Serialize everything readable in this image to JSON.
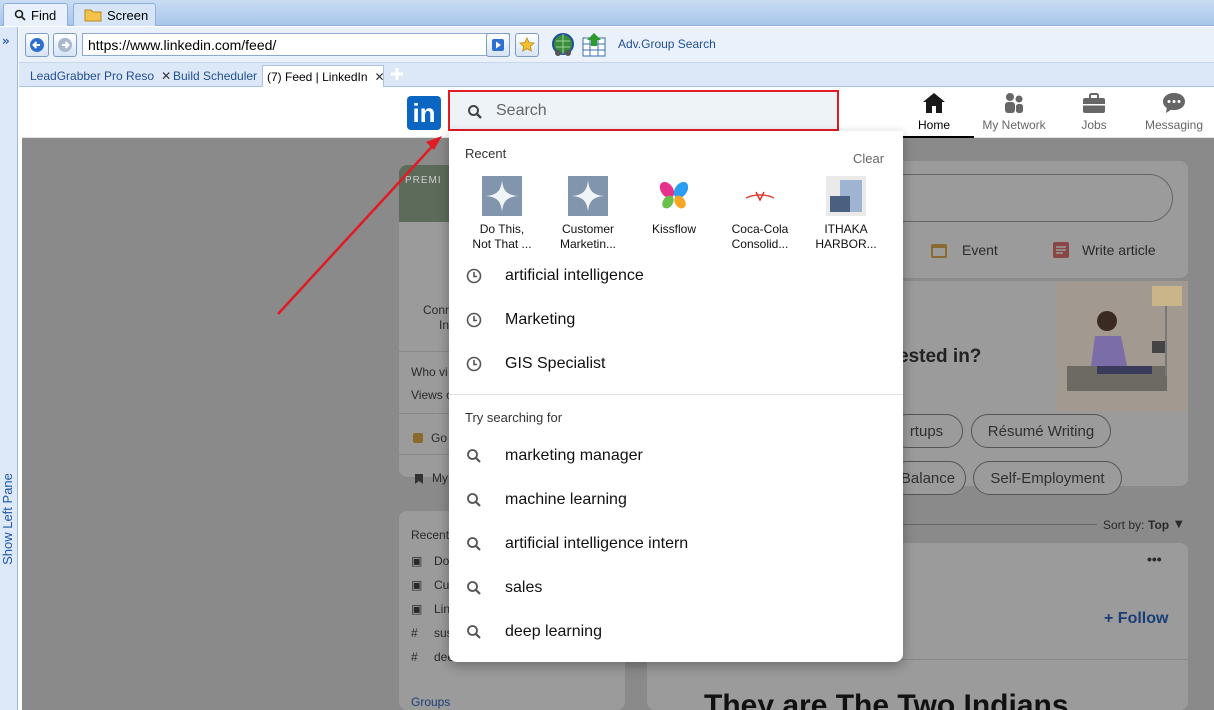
{
  "top_tabs": [
    {
      "label": "Find",
      "icon": "magnifier-icon"
    },
    {
      "label": "Screen",
      "icon": "folder-icon"
    }
  ],
  "left_pane": {
    "label": "Show Left Pane"
  },
  "toolbar": {
    "url": "https://www.linkedin.com/feed/",
    "adv_search": "Adv.Group Search"
  },
  "browser_tabs": [
    {
      "label": "LeadGrabber Pro Reso"
    },
    {
      "label": "Build Scheduler"
    },
    {
      "label": "(7) Feed | LinkedIn"
    }
  ],
  "linkedin": {
    "logo": "in",
    "search_placeholder": "Search",
    "nav": [
      {
        "label": "Home",
        "icon": "home-icon"
      },
      {
        "label": "My Network",
        "icon": "network-icon"
      },
      {
        "label": "Jobs",
        "icon": "briefcase-icon"
      },
      {
        "label": "Messaging",
        "icon": "messaging-icon"
      }
    ]
  },
  "dropdown": {
    "recent_title": "Recent",
    "clear": "Clear",
    "recent_entities": [
      {
        "line1": "Do This,",
        "line2": "Not That ..."
      },
      {
        "line1": "Customer",
        "line2": "Marketin..."
      },
      {
        "line1": "Kissflow",
        "line2": ""
      },
      {
        "line1": "Coca-Cola",
        "line2": "Consolid..."
      },
      {
        "line1": "ITHAKA",
        "line2": "HARBOR..."
      }
    ],
    "recent_searches": [
      "artificial intelligence",
      "Marketing",
      "GIS Specialist"
    ],
    "try_title": "Try searching for",
    "suggestions": [
      "marketing manager",
      "machine learning",
      "artificial intelligence intern",
      "sales",
      "deep learning"
    ]
  },
  "background": {
    "premium": "PREMI",
    "conn_1": "Conn",
    "conn_2": "In",
    "who_viewed": "Who vi",
    "views": "Views c",
    "go": "Go",
    "my": "My",
    "recent": "Recent",
    "recent_items": [
      "Do",
      "Cu",
      "Lin",
      "sus",
      "dee"
    ],
    "groups": "Groups",
    "event": "Event",
    "write_article": "Write article",
    "interested": "ested in?",
    "pill_startups": "rtups",
    "pill_resume": "Résumé Writing",
    "pill_balance": "Balance",
    "pill_self": "Self-Employment",
    "sort_by": "Sort by:",
    "sort_value": "Top",
    "more": "•••",
    "follow": "+ Follow",
    "headline": "They are The Two Indians"
  }
}
